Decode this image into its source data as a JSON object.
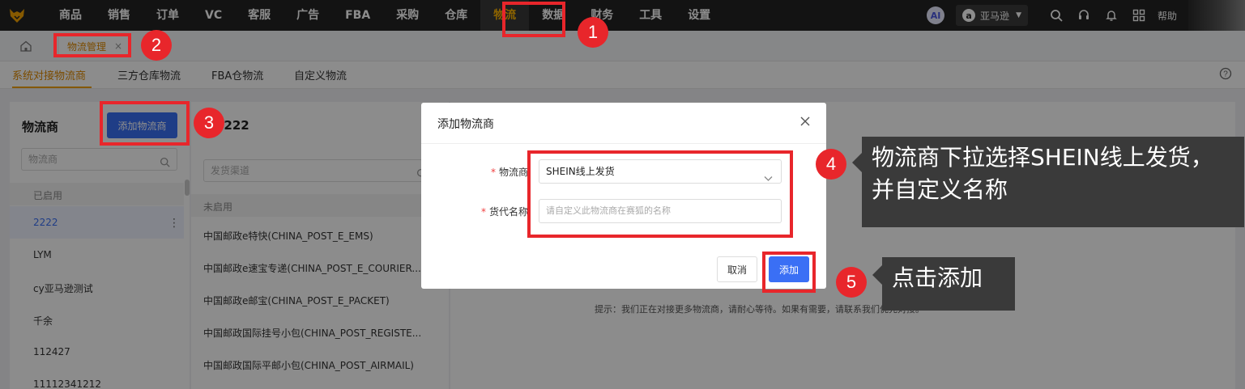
{
  "nav": {
    "items": [
      "商品",
      "销售",
      "订单",
      "VC",
      "客服",
      "广告",
      "FBA",
      "采购",
      "仓库",
      "物流",
      "数据",
      "财务",
      "工具",
      "设置"
    ],
    "active_index": 9,
    "ai_label": "AI",
    "store_icon": "a",
    "store_label": "亚马逊",
    "help_label": "帮助"
  },
  "tabs": {
    "page_tab_label": "物流管理",
    "close_glyph": "×"
  },
  "subtabs": [
    "系统对接物流商",
    "三方仓库物流",
    "FBA仓物流",
    "自定义物流"
  ],
  "left_col": {
    "title": "物流商",
    "add_button": "添加物流商",
    "search_placeholder": "物流商",
    "group_label": "已启用",
    "items": [
      "2222",
      "LYM",
      "cy亚马逊测试",
      "千余",
      "112427",
      "11112341212"
    ]
  },
  "mid_col": {
    "title": "2222",
    "search_placeholder": "发货渠道",
    "group_label": "未启用",
    "items": [
      "中国邮政e特快(CHINA_POST_E_EMS)",
      "中国邮政e速宝专递(CHINA_POST_E_COURIER...",
      "中国邮政e邮宝(CHINA_POST_E_PACKET)",
      "中国邮政国际挂号小包(CHINA_POST_REGISTE...",
      "中国邮政国际平邮小包(CHINA_POST_AIRMAIL)"
    ]
  },
  "hint": "提示：我们正在对接更多物流商，请耐心等待。如果有需要，请联系我们优先对接。",
  "modal": {
    "title": "添加物流商",
    "field1_label": "物流商",
    "field1_value": "SHEIN线上发货",
    "field2_label": "货代名称",
    "field2_placeholder": "请自定义此物流商在赛狐的名称",
    "cancel": "取消",
    "confirm": "添加"
  },
  "annotations": {
    "steps": [
      "1",
      "2",
      "3",
      "4",
      "5"
    ],
    "callout4": "物流商下拉选择SHEIN线上发货，并自定义名称",
    "callout5": "点击添加"
  },
  "colors": {
    "accent": "#f0a000",
    "primary": "#3a6ff5",
    "annotation_red": "#e8262b"
  }
}
